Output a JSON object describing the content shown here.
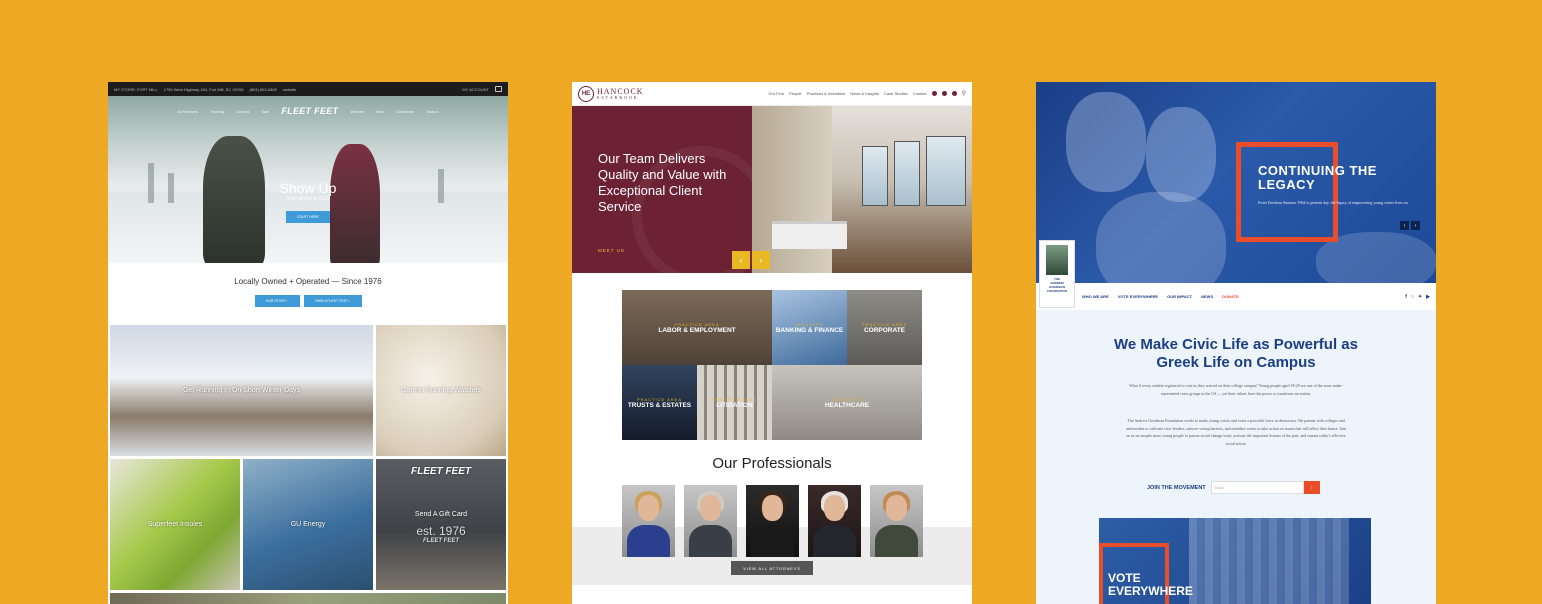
{
  "colors": {
    "background": "#EDA824",
    "ff_blue": "#3f9bd8",
    "he_maroon": "#6c2234",
    "he_gold": "#e8b923",
    "ag_blue": "#1b3e86",
    "ag_orange": "#e94d2a"
  },
  "fleetfeet": {
    "topbar": {
      "store": "MY STORE: FORT MILL",
      "address": "1750 West Highway 160, Fort Mill, SC 29708",
      "phone": "(803) 803-0800",
      "website": "website",
      "account": "MY ACCOUNT"
    },
    "nav": {
      "left": [
        "All Runners",
        "Training",
        "Journal",
        "Sale"
      ],
      "logo": "FLEET FEET",
      "right": [
        "Women",
        "Men",
        "Clearance",
        "Search"
      ]
    },
    "hero": {
      "title": "Show Up",
      "subtitle": "Start strong in 2019",
      "button": "START HERE"
    },
    "tagline": "Locally Owned + Operated — Since 1976",
    "buttons": [
      "OUR STORY ›",
      "OWN A FLEET FEET ›"
    ],
    "tiles": [
      "Get Running In On Short Winter Days",
      "Garmin Running Watches",
      "Superfeet Insoles",
      "GU Energy",
      "Send A Gift Card"
    ],
    "giftcard": {
      "logo": "FLEET FEET",
      "est": "est. 1976",
      "logo2": "FLEET FEET"
    }
  },
  "hancock": {
    "logo": {
      "mark": "HE",
      "name": "HANCOCK",
      "sub": "ESTABROOK"
    },
    "nav": [
      "Our Firm",
      "People",
      "Practices & Industries",
      "News & Insights",
      "Case Studies",
      "Contact"
    ],
    "hero": {
      "title": "Our Team Delivers Quality and Value with Exceptional Client Service",
      "cta": "MEET US"
    },
    "practices": [
      {
        "kicker": "PRACTICE AREA",
        "label": "LABOR & EMPLOYMENT"
      },
      {
        "kicker": "INDUSTRY",
        "label": "BANKING & FINANCE"
      },
      {
        "kicker": "PRACTICE AREA",
        "label": "CORPORATE"
      },
      {
        "kicker": "PRACTICE AREA",
        "label": "TRUSTS & ESTATES"
      },
      {
        "kicker": "PRACTICE AREA",
        "label": "LITIGATION"
      },
      {
        "kicker": "INDUSTRY",
        "label": "HEALTHCARE"
      }
    ],
    "professionals_title": "Our Professionals",
    "view_all": "VIEW ALL ATTORNEYS"
  },
  "goodman": {
    "hero": {
      "title_line1": "CONTINUING THE",
      "title_line2": "LEGACY",
      "subtitle": "From Freedom Summer 1964 to present day, the legacy of empowering young voters lives on."
    },
    "logo": {
      "line1": "THE",
      "line2": "ANDREW",
      "line3": "GOODMAN",
      "line4": "FOUNDATION"
    },
    "nav": [
      "WHO WE ARE",
      "VOTE EVERYWHERE",
      "OUR IMPACT",
      "NEWS",
      "DONATE"
    ],
    "headline": "We Make Civic Life as Powerful as Greek Life on Campus",
    "paragraph1": "What if every student registered to vote as they arrived on their college campus? Young people aged 18-29 are one of the most under-represented voter groups in the US — yet their values have the power to transform our nation.",
    "paragraph2": "The Andrew Goodman Foundation works to make young voices and votes a powerful force in democracy. We partner with colleges and universities to cultivate civic leaders, remove voting barriers, and mobilize voters to take action on issues that will affect their future. Join us as we inspire more young people to pursue social change work, activate the important lessons of the past, and sustain today's effective social action.",
    "join": {
      "label": "JOIN THE MOVEMENT",
      "placeholder": "Email",
      "go": "›"
    },
    "card": {
      "line1": "VOTE",
      "line2": "EVERYWHERE"
    }
  }
}
